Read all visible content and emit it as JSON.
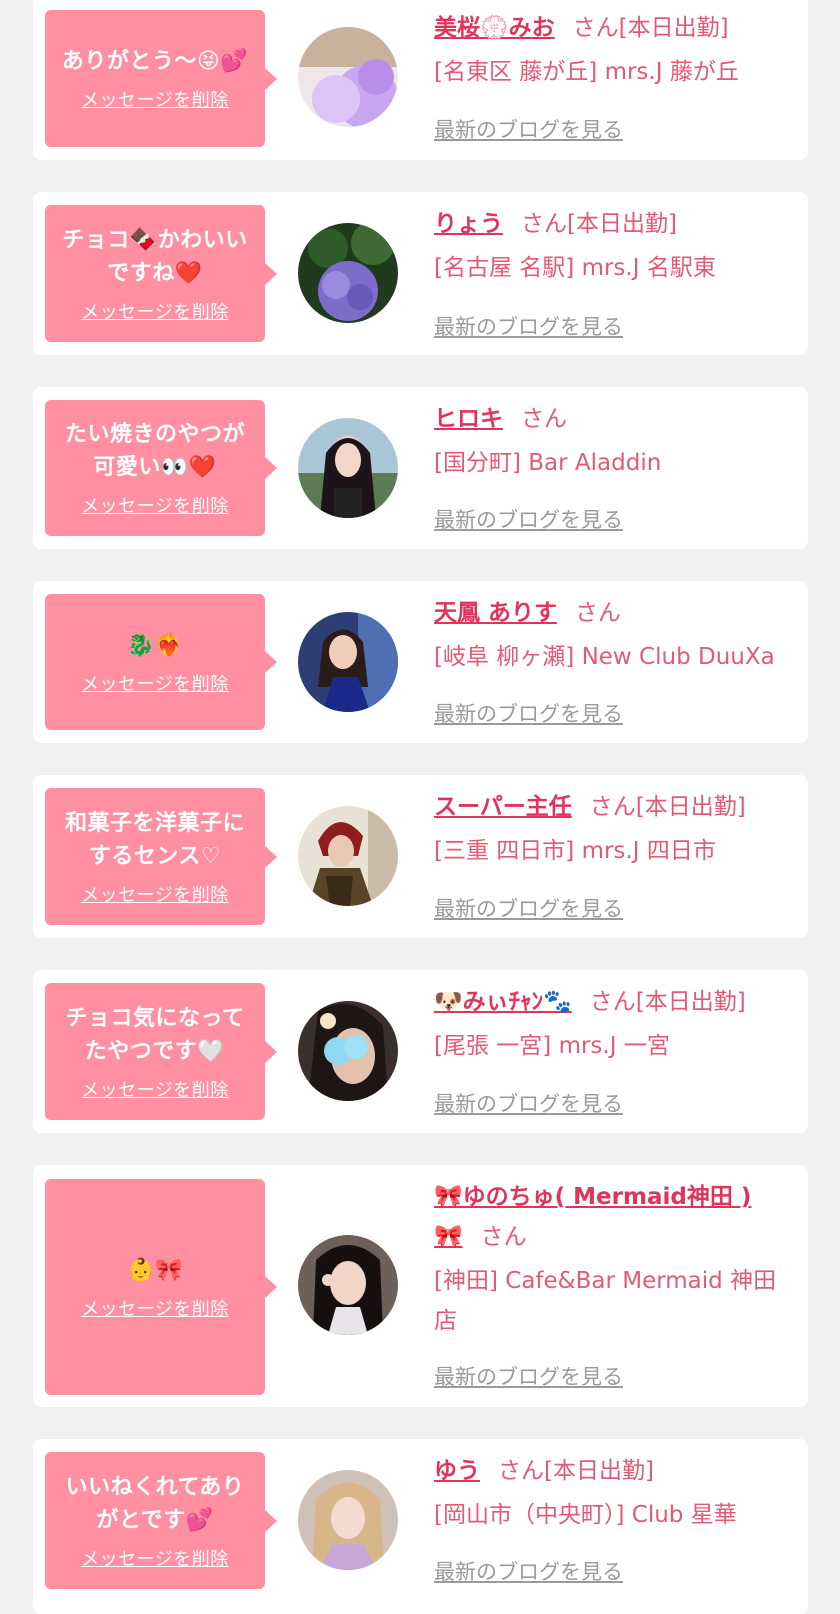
{
  "cards": [
    {
      "message": "ありがとう〜😝💕",
      "delete_label": "メッセージを削除",
      "name": "美桜💮みお",
      "honorific": "さん[本日出勤]",
      "shop": "[名東区 藤が丘] mrs.J 藤が丘",
      "blog_label": "最新のブログを見る",
      "avatar_icon": "purple-heart-photo"
    },
    {
      "message": "チョコ🍫かわいいですね❤️",
      "delete_label": "メッセージを削除",
      "name": "りょう",
      "honorific": "さん[本日出勤]",
      "shop": "[名古屋 名駅] mrs.J 名駅東",
      "blog_label": "最新のブログを見る",
      "avatar_icon": "hydrangea-photo"
    },
    {
      "message": "たい焼きのやつが可愛い👀❤️",
      "delete_label": "メッセージを削除",
      "name": "ヒロキ",
      "honorific": "さん",
      "shop": "[国分町] Bar Aladdin",
      "blog_label": "最新のブログを見る",
      "avatar_icon": "portrait-photo"
    },
    {
      "message": "🐉❤️‍🔥",
      "delete_label": "メッセージを削除",
      "name": "天鳳 ありす",
      "honorific": "さん",
      "shop": "[岐阜 柳ヶ瀬] New Club DuuXa",
      "blog_label": "最新のブログを見る",
      "avatar_icon": "portrait-photo"
    },
    {
      "message": "和菓子を洋菓子にするセンス♡",
      "delete_label": "メッセージを削除",
      "name": "スーパー主任",
      "honorific": "さん[本日出勤]",
      "shop": "[三重 四日市] mrs.J 四日市",
      "blog_label": "最新のブログを見る",
      "avatar_icon": "portrait-photo"
    },
    {
      "message": "チョコ気になってたやつです🤍",
      "delete_label": "メッセージを削除",
      "name": "🐶みぃﾁｬﾝ🐾",
      "honorific": "さん[本日出勤]",
      "shop": "[尾張 一宮] mrs.J 一宮",
      "blog_label": "最新のブログを見る",
      "avatar_icon": "portrait-photo"
    },
    {
      "message": "👶🎀",
      "delete_label": "メッセージを削除",
      "name": "🎀ゆのちゅ( Mermaid神田 )🎀",
      "honorific": "さん",
      "shop": "[神田] Cafe&Bar Mermaid 神田店",
      "blog_label": "最新のブログを見る",
      "avatar_icon": "portrait-photo"
    },
    {
      "message": "いいねくれてありがとです💕",
      "delete_label": "メッセージを削除",
      "name": "ゆう",
      "honorific": "さん[本日出勤]",
      "shop": "[岡山市（中央町）] Club 星華",
      "blog_label": "最新のブログを見る",
      "avatar_icon": "portrait-photo"
    }
  ]
}
